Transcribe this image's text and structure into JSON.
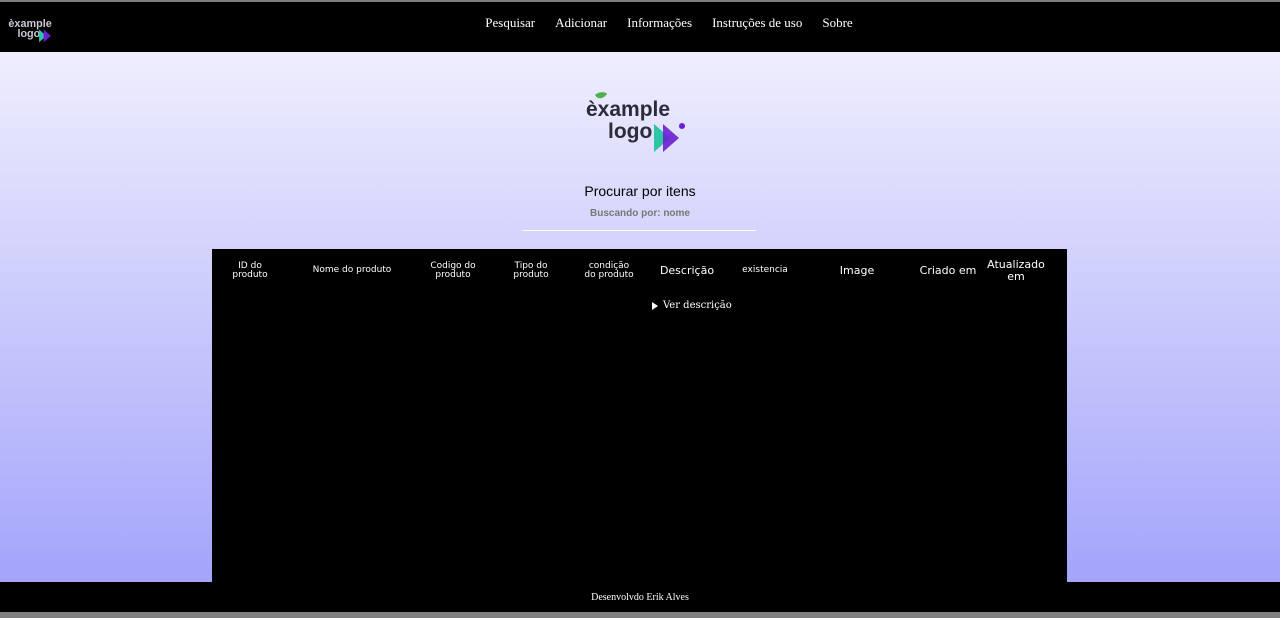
{
  "brand": {
    "logo_line1": "èxample",
    "logo_line2": "logo",
    "colors": {
      "leaf": "#4caf50",
      "arrow_teal": "#2ec4a6",
      "arrow_purple": "#6a1fd0",
      "text": "#2b2b3a"
    }
  },
  "nav": {
    "items": [
      {
        "label": "Pesquisar"
      },
      {
        "label": "Adicionar"
      },
      {
        "label": "Informações"
      },
      {
        "label": "Instruções de uso"
      },
      {
        "label": "Sobre"
      }
    ]
  },
  "search": {
    "title": "Procurar por itens",
    "status": "Buscando por: nome",
    "placeholder": ""
  },
  "table": {
    "columns": [
      {
        "label": "ID do produto"
      },
      {
        "label": "Nome do produto"
      },
      {
        "label": "Codigo do produto"
      },
      {
        "label": "Tipo do produto"
      },
      {
        "label": "condição do produto"
      },
      {
        "label": "Descrição"
      },
      {
        "label": "existencia"
      },
      {
        "label": "Image"
      },
      {
        "label": "Criado em"
      },
      {
        "label": "Atualizado em"
      }
    ],
    "details_label": "Ver descrição"
  },
  "footer": {
    "text": "Desenvolvdo Erik Alves"
  }
}
